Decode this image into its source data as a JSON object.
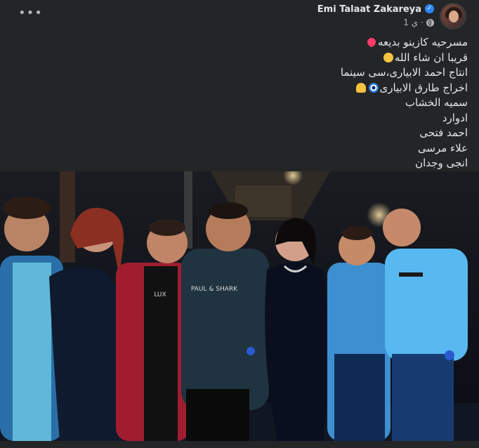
{
  "post": {
    "author": "Emi Talaat Zakareya",
    "timestamp": "1 ي",
    "audience_icon": "globe-icon",
    "verified_icon": "verified-badge-icon",
    "more_icon": "more-options-icon",
    "more_label": "•••",
    "lines": [
      "مسرحيه كازينو بديعه",
      "قريبا ان شاء الله",
      "انتاج احمد الابيارى،سى سينما",
      "اخراج طارق الابيارى",
      "سميه الخشاب",
      "ادوارد",
      "احمد فتحى",
      "علاء مرسى",
      "انجى وجدان"
    ],
    "emojis": [
      "sparkling-heart",
      "performing-arts",
      "nazar-amulet",
      "folded-hands"
    ],
    "shirt_print": "PAUL & SHARK"
  },
  "colors": {
    "background": "#242526",
    "text": "#e4e6eb",
    "secondary": "#b0b3b8",
    "verified": "#2d88ff"
  }
}
